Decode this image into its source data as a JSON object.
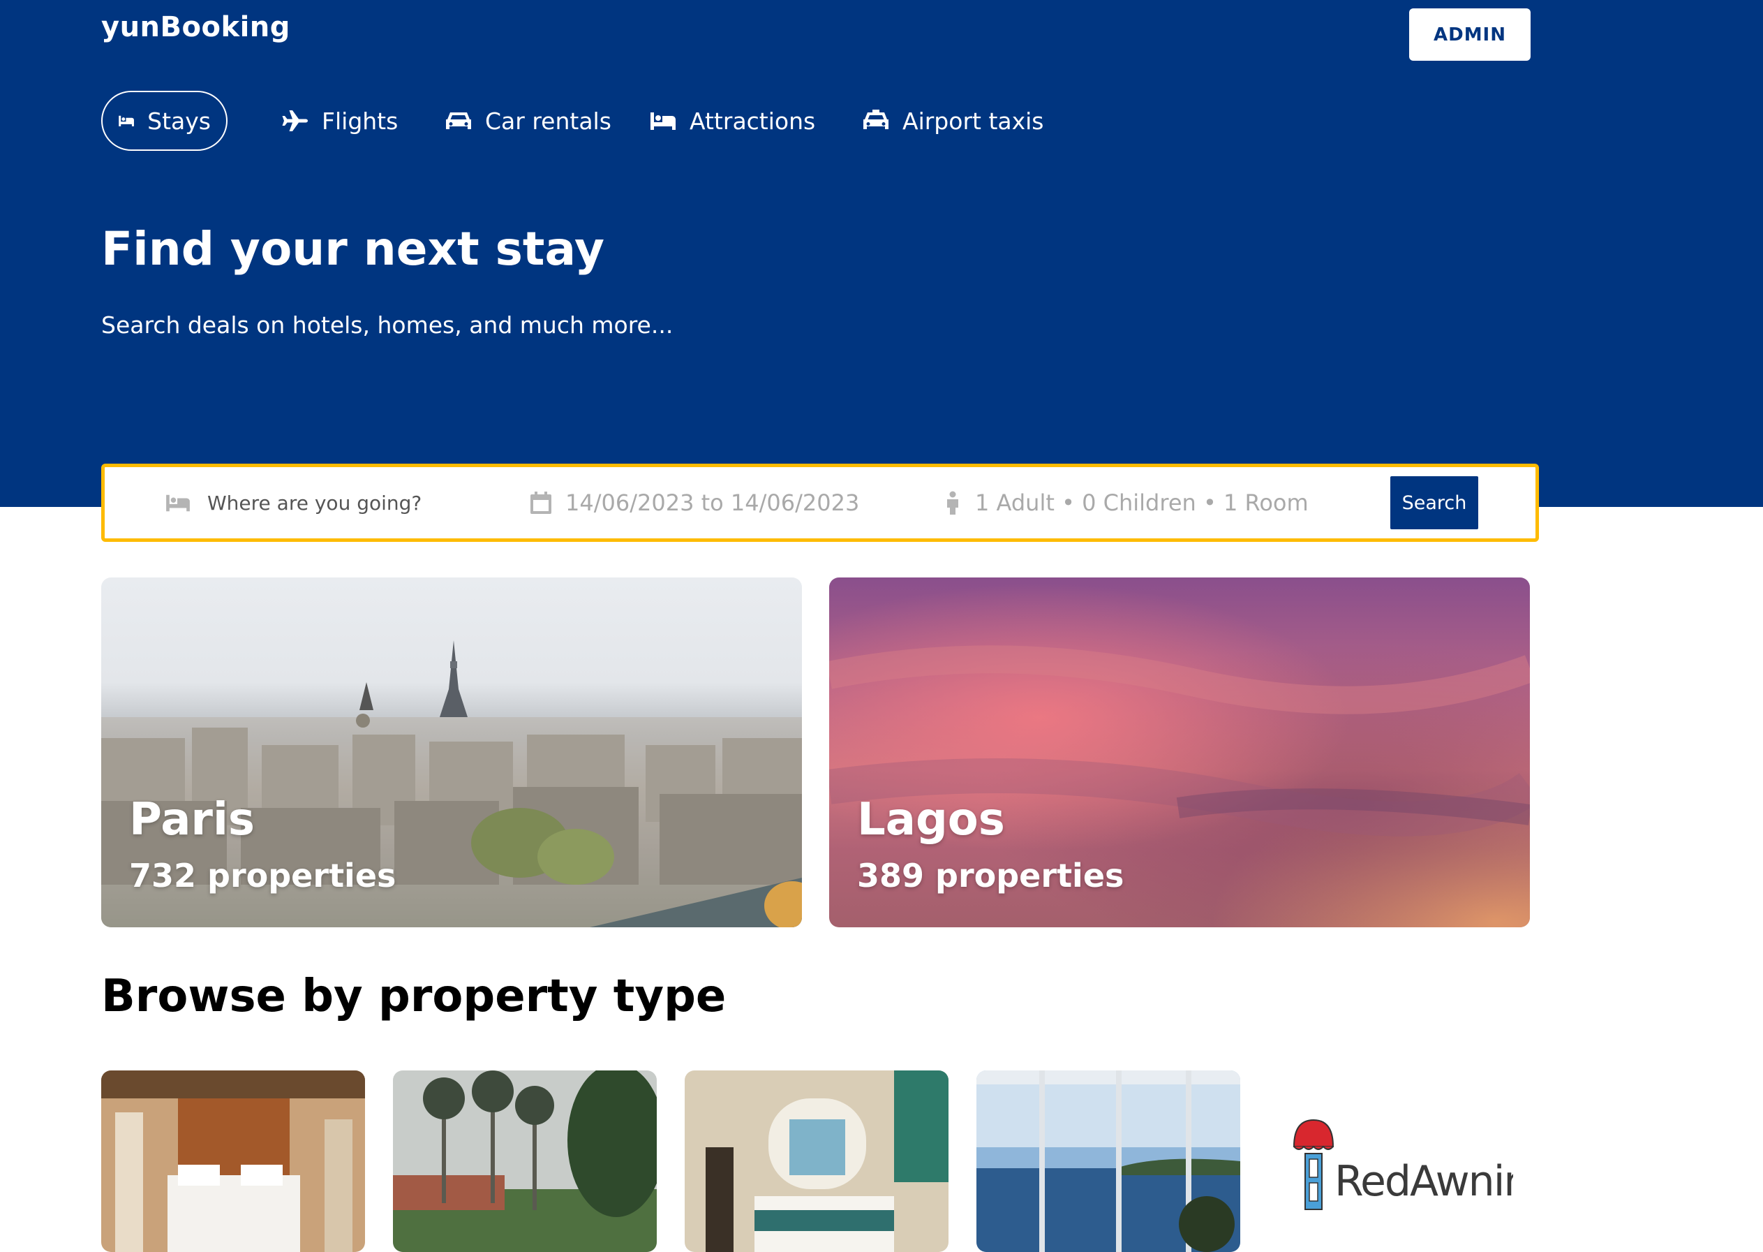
{
  "header": {
    "logo": "yunBooking",
    "admin_label": "ADMIN"
  },
  "nav": {
    "items": [
      {
        "label": "Stays",
        "icon": "bed-icon",
        "active": true
      },
      {
        "label": "Flights",
        "icon": "plane-icon"
      },
      {
        "label": "Car rentals",
        "icon": "car-icon"
      },
      {
        "label": "Attractions",
        "icon": "bed-icon"
      },
      {
        "label": "Airport taxis",
        "icon": "taxi-icon"
      }
    ]
  },
  "hero": {
    "title": "Find your next stay",
    "subtitle": "Search deals on hotels, homes, and much more..."
  },
  "search": {
    "destination_placeholder": "Where are you going?",
    "dates": "14/06/2023 to 14/06/2023",
    "guests": "1 Adult • 0 Children • 1 Room",
    "button_label": "Search"
  },
  "featured": [
    {
      "city": "Paris",
      "count": "732 properties"
    },
    {
      "city": "Lagos",
      "count": "389 properties"
    }
  ],
  "property_types": {
    "title": "Browse by property type",
    "images": [
      "hotel-room",
      "palm-trees-resort",
      "hotel-suite",
      "sea-view-window",
      "RedAwning-logo"
    ]
  },
  "colors": {
    "brand": "#003580",
    "search_border": "#febb02"
  }
}
